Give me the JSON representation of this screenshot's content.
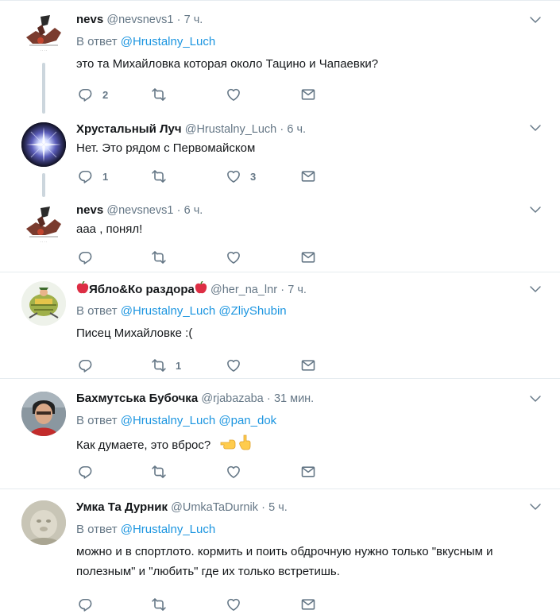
{
  "tweets": [
    {
      "name": "nevs",
      "handle": "@nevsnevs1",
      "dot": "·",
      "time": "7 ч.",
      "reply_prefix": "В ответ",
      "mentions": [
        "@Hrustalny_Luch"
      ],
      "text": "это та Михайловка которая около Тацино и Чапаевки?",
      "replies": "2",
      "retweets": "",
      "likes": ""
    },
    {
      "name": "Хрустальный Луч",
      "handle": "@Hrustalny_Luch",
      "dot": "·",
      "time": "6 ч.",
      "text": "Нет. Это рядом с Первомайском",
      "replies": "1",
      "retweets": "",
      "likes": "3"
    },
    {
      "name": "nevs",
      "handle": "@nevsnevs1",
      "dot": "·",
      "time": "6 ч.",
      "text": "ааа , понял!",
      "replies": "",
      "retweets": "",
      "likes": ""
    },
    {
      "name": "Ябло&Ко раздора",
      "handle": "@her_na_lnr",
      "dot": "·",
      "time": "7 ч.",
      "reply_prefix": "В ответ",
      "mentions": [
        "@Hrustalny_Luch",
        "@ZliyShubin"
      ],
      "text": "Писец Михайловке :(",
      "replies": "",
      "retweets": "1",
      "likes": ""
    },
    {
      "name": "Бахмутська Бубочка",
      "handle": "@rjabazaba",
      "dot": "·",
      "time": "31 мин.",
      "reply_prefix": "В ответ",
      "mentions": [
        "@Hrustalny_Luch",
        "@pan_dok"
      ],
      "text": "Как думаете, это вброс?",
      "replies": "",
      "retweets": "",
      "likes": ""
    },
    {
      "name": "Умка Та Дурник",
      "handle": "@UmkaTaDurnik",
      "dot": "·",
      "time": "5 ч.",
      "reply_prefix": "В ответ",
      "mentions": [
        "@Hrustalny_Luch"
      ],
      "text": "можно и в спортлото. кормить и поить обдрочную нужно только \"вкусным и полезным\" и \"любить\" где их только встретишь.",
      "replies": "",
      "retweets": "",
      "likes": ""
    }
  ],
  "icons": {
    "reply": "reply-icon",
    "retweet": "retweet-icon",
    "like": "heart-icon",
    "dm": "envelope-icon",
    "more": "chevron-down-icon"
  },
  "colors": {
    "link": "#1b95e0",
    "muted": "#657786",
    "text": "#14171a",
    "separator": "#e6ecf0"
  }
}
